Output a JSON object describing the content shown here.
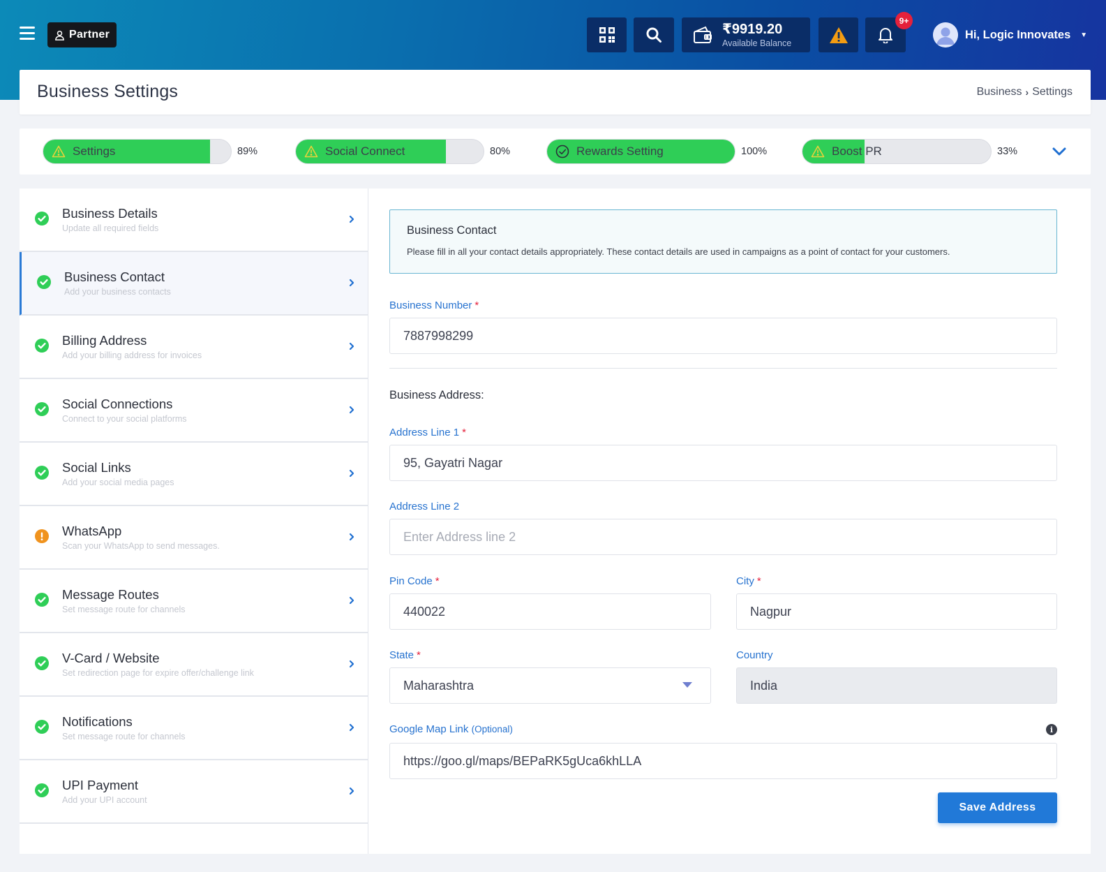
{
  "header": {
    "partner_label": "Partner",
    "wallet_amount": "₹9919.20",
    "wallet_sub": "Available Balance",
    "notification_badge": "9+",
    "user_greeting": "Hi, Logic Innovates"
  },
  "page": {
    "title": "Business Settings",
    "breadcrumb": [
      "Business",
      "Settings"
    ]
  },
  "progress": [
    {
      "label": "Settings",
      "percent": 89,
      "percent_text": "89%",
      "status": "warning"
    },
    {
      "label": "Social Connect",
      "percent": 80,
      "percent_text": "80%",
      "status": "warning"
    },
    {
      "label": "Rewards Setting",
      "percent": 100,
      "percent_text": "100%",
      "status": "complete"
    },
    {
      "label": "Boost PR",
      "percent": 33,
      "percent_text": "33%",
      "status": "warning"
    }
  ],
  "sidebar": {
    "items": [
      {
        "title": "Business Details",
        "subtitle": "Update all required fields",
        "status": "complete"
      },
      {
        "title": "Business Contact",
        "subtitle": "Add your business contacts",
        "status": "complete"
      },
      {
        "title": "Billing Address",
        "subtitle": "Add your billing address for invoices",
        "status": "complete"
      },
      {
        "title": "Social Connections",
        "subtitle": "Connect to your social platforms",
        "status": "complete"
      },
      {
        "title": "Social Links",
        "subtitle": "Add your social media pages",
        "status": "complete"
      },
      {
        "title": "WhatsApp",
        "subtitle": "Scan your WhatsApp to send messages.",
        "status": "warning"
      },
      {
        "title": "Message Routes",
        "subtitle": "Set message route for channels",
        "status": "complete"
      },
      {
        "title": "V-Card / Website",
        "subtitle": "Set redirection page for expire offer/challenge link",
        "status": "complete"
      },
      {
        "title": "Notifications",
        "subtitle": "Set message route for channels",
        "status": "complete"
      },
      {
        "title": "UPI Payment",
        "subtitle": "Add your UPI account",
        "status": "complete"
      }
    ]
  },
  "form": {
    "info_title": "Business Contact",
    "info_text": "Please fill in all your contact details appropriately. These contact details are used in campaigns as a point of contact for your customers.",
    "business_number_label": "Business Number",
    "business_number_value": "7887998299",
    "address_heading": "Business Address:",
    "address1_label": "Address Line 1",
    "address1_value": "95, Gayatri Nagar",
    "address2_label": "Address Line 2",
    "address2_placeholder": "Enter Address line 2",
    "pincode_label": "Pin Code",
    "pincode_value": "440022",
    "city_label": "City",
    "city_value": "Nagpur",
    "state_label": "State",
    "state_value": "Maharashtra",
    "country_label": "Country",
    "country_value": "India",
    "map_label": "Google Map Link",
    "map_optional": "(Optional)",
    "map_value": "https://goo.gl/maps/BEPaRK5gUca6khLLA",
    "required_mark": "*",
    "save_label": "Save Address"
  },
  "colors": {
    "accent": "#2179d8",
    "progress_fill": "#2fce57",
    "complete": "#2fce57",
    "warning": "#f0931e",
    "header_dark": "#0a2d67"
  }
}
